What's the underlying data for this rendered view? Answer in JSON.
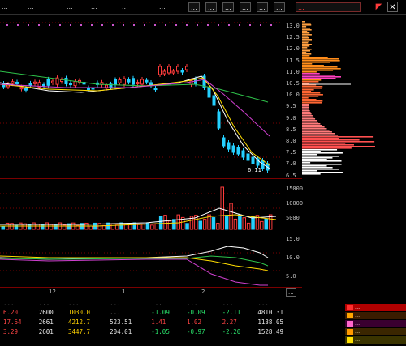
{
  "header": {
    "tabs": [
      "...",
      "...",
      "...",
      "...",
      "...",
      "..."
    ],
    "buttons": [
      "...",
      "...",
      "...",
      "...",
      "...",
      "...",
      "..."
    ],
    "active_button_index": 6,
    "close_glyph": "✕",
    "flag_glyph": "◤"
  },
  "price_axis": [
    "13.0",
    "12.5",
    "12.0",
    "11.5",
    "11.0",
    "10.5",
    "10.0",
    "9.5",
    "9.0",
    "8.5",
    "8.0",
    "7.5",
    "7.0",
    "6.5"
  ],
  "low_price_label": "6.11",
  "volume_axis": [
    "15000",
    "10000",
    "5000"
  ],
  "indicator_axis": [
    "15.0",
    "10.0",
    "5.0"
  ],
  "date_axis": [
    "12",
    "1",
    "2"
  ],
  "bottom_label": "...",
  "ticker_table": {
    "headers": [
      "...",
      "...",
      "...",
      "...",
      "...",
      "...",
      "...",
      "..."
    ],
    "rows": [
      [
        "6.20",
        "2600",
        "1030.0",
        "...",
        "-1.09",
        "-0.09",
        "-2.11",
        "4810.31"
      ],
      [
        "17.64",
        "2661",
        "4212.7",
        "523.51",
        "1.41",
        "1.02",
        "2.27",
        "1138.05"
      ],
      [
        "3.29",
        "2601",
        "3447.7",
        "204.01",
        "-1.05",
        "-0.97",
        "-2.20",
        "1528.49"
      ]
    ]
  },
  "legend": {
    "rows": [
      {
        "text": "...",
        "color": "#ff2f2f"
      },
      {
        "text": "...",
        "color": "#ffa500"
      },
      {
        "text": "...",
        "color": "#ff66cc"
      },
      {
        "text": "...",
        "color": "#ff9900"
      },
      {
        "text": "...",
        "color": "#ffe000"
      }
    ]
  },
  "colors": {
    "up": "#ff3b3b",
    "down": "#25d0ff",
    "ma_white": "#ffffff",
    "ma_yellow": "#ffdd00",
    "ma_purple": "#d040d0",
    "ma_green": "#2ec24a"
  }
}
